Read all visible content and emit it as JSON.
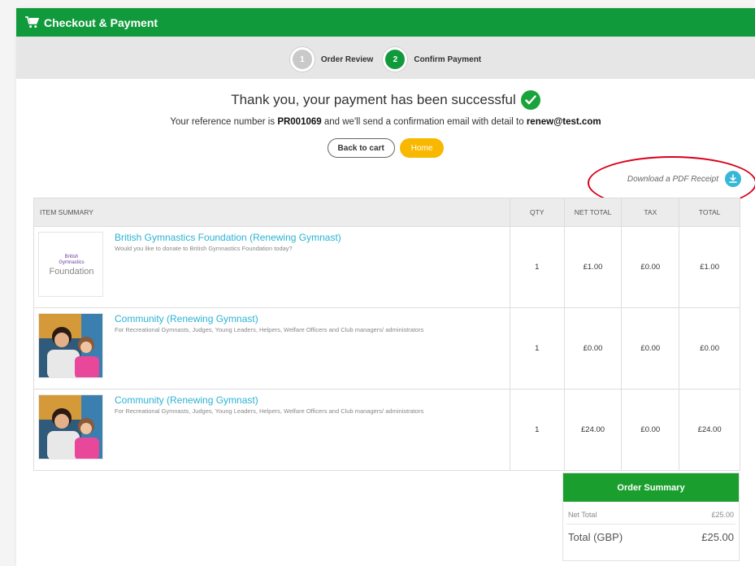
{
  "header": {
    "title": "Checkout & Payment"
  },
  "steps": [
    {
      "number": "1",
      "label": "Order Review",
      "state": "inactive"
    },
    {
      "number": "2",
      "label": "Confirm Payment",
      "state": "active"
    }
  ],
  "success": {
    "message": "Thank you, your payment has been successful",
    "ref_prefix": "Your reference number is",
    "ref_number": "PR001069",
    "ref_mid": "and we'll send a confirmation email with detail to",
    "email": "renew@test.com"
  },
  "buttons": {
    "back_label": "Back to cart",
    "home_label": "Home"
  },
  "pdf": {
    "label": "Download a PDF Receipt"
  },
  "table": {
    "headers": {
      "item": "ITEM SUMMARY",
      "qty": "QTY",
      "net": "NET TOTAL",
      "tax": "TAX",
      "total": "TOTAL"
    },
    "rows": [
      {
        "title": "British Gymnastics Foundation (Renewing Gymnast)",
        "desc": "Would you like to donate to British Gymnastics Foundation today?",
        "qty": "1",
        "net": "£1.00",
        "tax": "£0.00",
        "total": "£1.00",
        "thumb_text_top": "British",
        "thumb_text_mid": "Gymnastics",
        "thumb_text_bottom": "Foundation"
      },
      {
        "title": "Community (Renewing Gymnast)",
        "desc": "For Recreational Gymnasts, Judges, Young Leaders, Helpers, Welfare Officers and Club managers/ administrators",
        "qty": "1",
        "net": "£0.00",
        "tax": "£0.00",
        "total": "£0.00"
      },
      {
        "title": "Community (Renewing Gymnast)",
        "desc": "For Recreational Gymnasts, Judges, Young Leaders, Helpers, Welfare Officers and Club managers/ administrators",
        "qty": "1",
        "net": "£24.00",
        "tax": "£0.00",
        "total": "£24.00"
      }
    ]
  },
  "summary": {
    "title": "Order Summary",
    "net_label": "Net Total",
    "net_value": "£25.00",
    "total_label": "Total (GBP)",
    "total_value": "£25.00"
  },
  "colors": {
    "brand_green": "#119a3c",
    "accent_yellow": "#f9b800",
    "link_blue": "#2bb2d3",
    "highlight_red": "#d9001b"
  }
}
